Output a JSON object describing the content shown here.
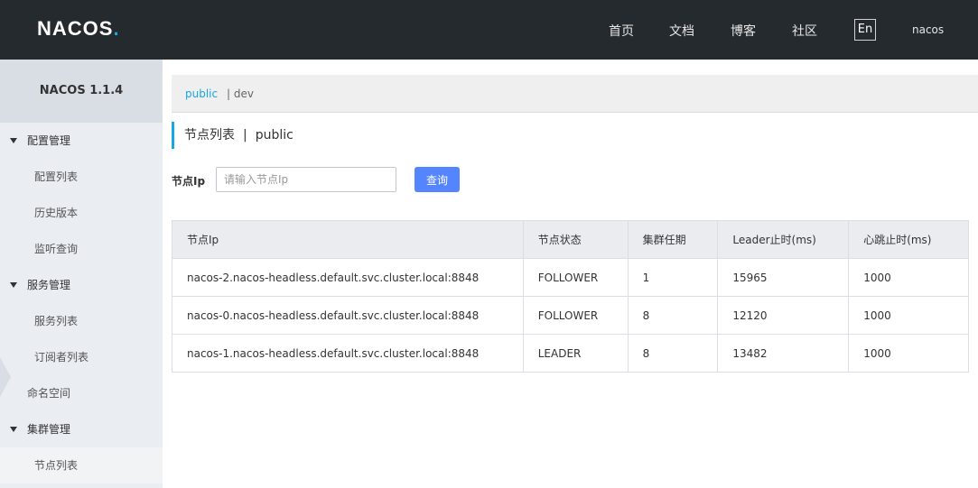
{
  "header": {
    "logo_text": "NACOS",
    "logo_dot": ".",
    "nav": [
      "首页",
      "文档",
      "博客",
      "社区"
    ],
    "lang": "En",
    "user": "nacos"
  },
  "sidebar": {
    "title": "NACOS 1.1.4",
    "groups": {
      "config": "配置管理",
      "config_list": "配置列表",
      "history": "历史版本",
      "listen": "监听查询",
      "service": "服务管理",
      "service_list": "服务列表",
      "subscriber_list": "订阅者列表",
      "namespace": "命名空间",
      "cluster": "集群管理",
      "node_list": "节点列表"
    }
  },
  "namespaces": {
    "active": "public",
    "separator": "|",
    "other": "dev"
  },
  "page": {
    "title": "节点列表",
    "separator": "|",
    "namespace": "public"
  },
  "filter": {
    "label": "节点Ip",
    "placeholder": "请输入节点Ip",
    "value": "",
    "query_label": "查询"
  },
  "table": {
    "headers": [
      "节点Ip",
      "节点状态",
      "集群任期",
      "Leader止时(ms)",
      "心跳止时(ms)"
    ],
    "rows": [
      [
        "nacos-2.nacos-headless.default.svc.cluster.local:8848",
        "FOLLOWER",
        "1",
        "15965",
        "1000"
      ],
      [
        "nacos-0.nacos-headless.default.svc.cluster.local:8848",
        "FOLLOWER",
        "8",
        "12120",
        "1000"
      ],
      [
        "nacos-1.nacos-headless.default.svc.cluster.local:8848",
        "LEADER",
        "8",
        "13482",
        "1000"
      ]
    ]
  },
  "colors": {
    "topbar": "#252a2f",
    "accent": "#1aa6e2",
    "button": "#5584ff",
    "sidebar": "#eaedf1"
  }
}
